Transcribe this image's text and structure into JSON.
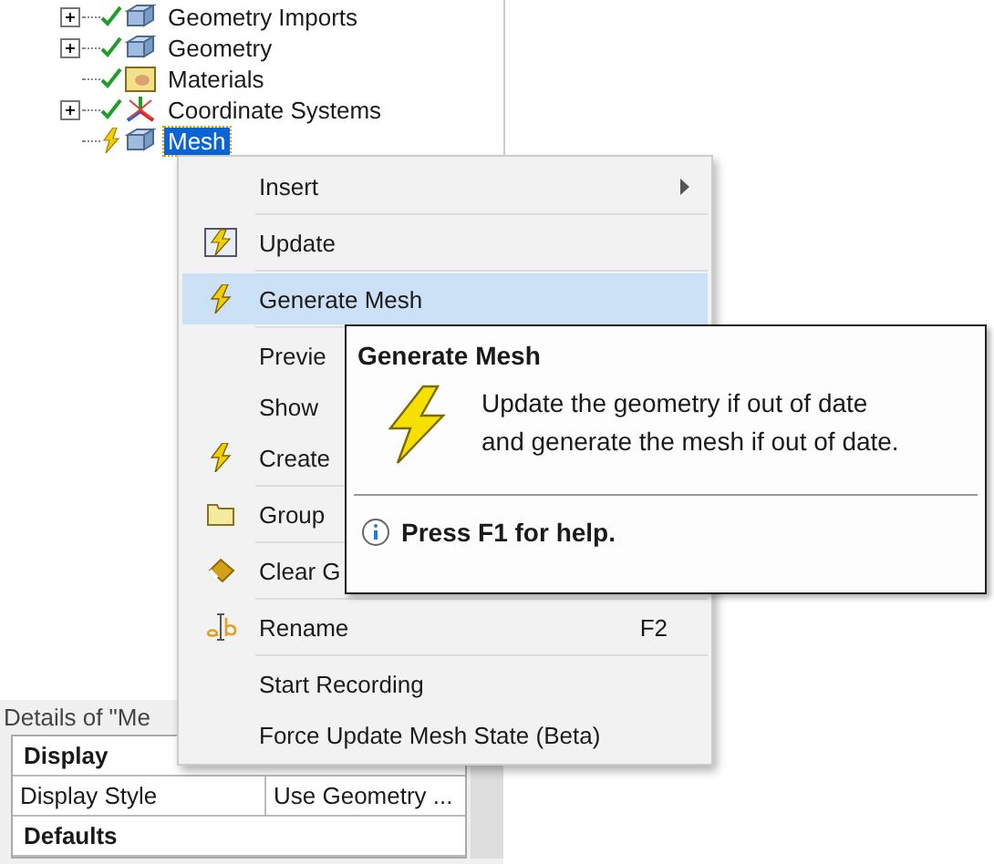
{
  "tree": {
    "items": [
      {
        "label": "Geometry Imports",
        "expandable": true,
        "up_to_date": true,
        "kind": "imports",
        "selected": false
      },
      {
        "label": "Geometry",
        "expandable": true,
        "up_to_date": true,
        "kind": "cube",
        "selected": false
      },
      {
        "label": "Materials",
        "expandable": false,
        "up_to_date": true,
        "kind": "materials",
        "selected": false
      },
      {
        "label": "Coordinate Systems",
        "expandable": true,
        "up_to_date": true,
        "kind": "axes",
        "selected": false
      },
      {
        "label": "Mesh",
        "expandable": false,
        "up_to_date": false,
        "kind": "cube",
        "selected": true
      }
    ]
  },
  "details": {
    "title": "Details of \"Me",
    "rows": [
      {
        "kind": "group",
        "label": "Display"
      },
      {
        "kind": "property",
        "label": "Display Style",
        "value": "Use Geometry ..."
      },
      {
        "kind": "group",
        "label": "Defaults"
      }
    ]
  },
  "context_menu": {
    "items": [
      {
        "kind": "plain",
        "label": "Insert",
        "submenu": true,
        "selected": false
      },
      {
        "kind": "separator"
      },
      {
        "kind": "update",
        "label": "Update",
        "submenu": false,
        "selected": false
      },
      {
        "kind": "separator"
      },
      {
        "kind": "bolt",
        "label": "Generate Mesh",
        "submenu": false,
        "selected": true
      },
      {
        "kind": "separator"
      },
      {
        "kind": "plain",
        "label": "Previe",
        "submenu": false,
        "selected": false
      },
      {
        "kind": "plain",
        "label": "Show",
        "submenu": false,
        "selected": false
      },
      {
        "kind": "bolt",
        "label": "Create",
        "submenu": false,
        "selected": false
      },
      {
        "kind": "separator"
      },
      {
        "kind": "folder",
        "label": "Group",
        "submenu": false,
        "selected": false
      },
      {
        "kind": "separator"
      },
      {
        "kind": "eraser",
        "label": "Clear G",
        "submenu": false,
        "selected": false
      },
      {
        "kind": "separator"
      },
      {
        "kind": "rename",
        "label": "Rename",
        "shortcut": "F2",
        "submenu": false,
        "selected": false
      },
      {
        "kind": "separator"
      },
      {
        "kind": "plain",
        "label": "Start Recording",
        "submenu": false,
        "selected": false
      },
      {
        "kind": "plain",
        "label": "Force Update Mesh State (Beta)",
        "submenu": false,
        "selected": false
      }
    ]
  },
  "tooltip": {
    "title": "Generate Mesh",
    "lines": [
      "Update the geometry if out of date",
      "and generate the mesh if out of date."
    ],
    "help": "Press F1 for help."
  }
}
